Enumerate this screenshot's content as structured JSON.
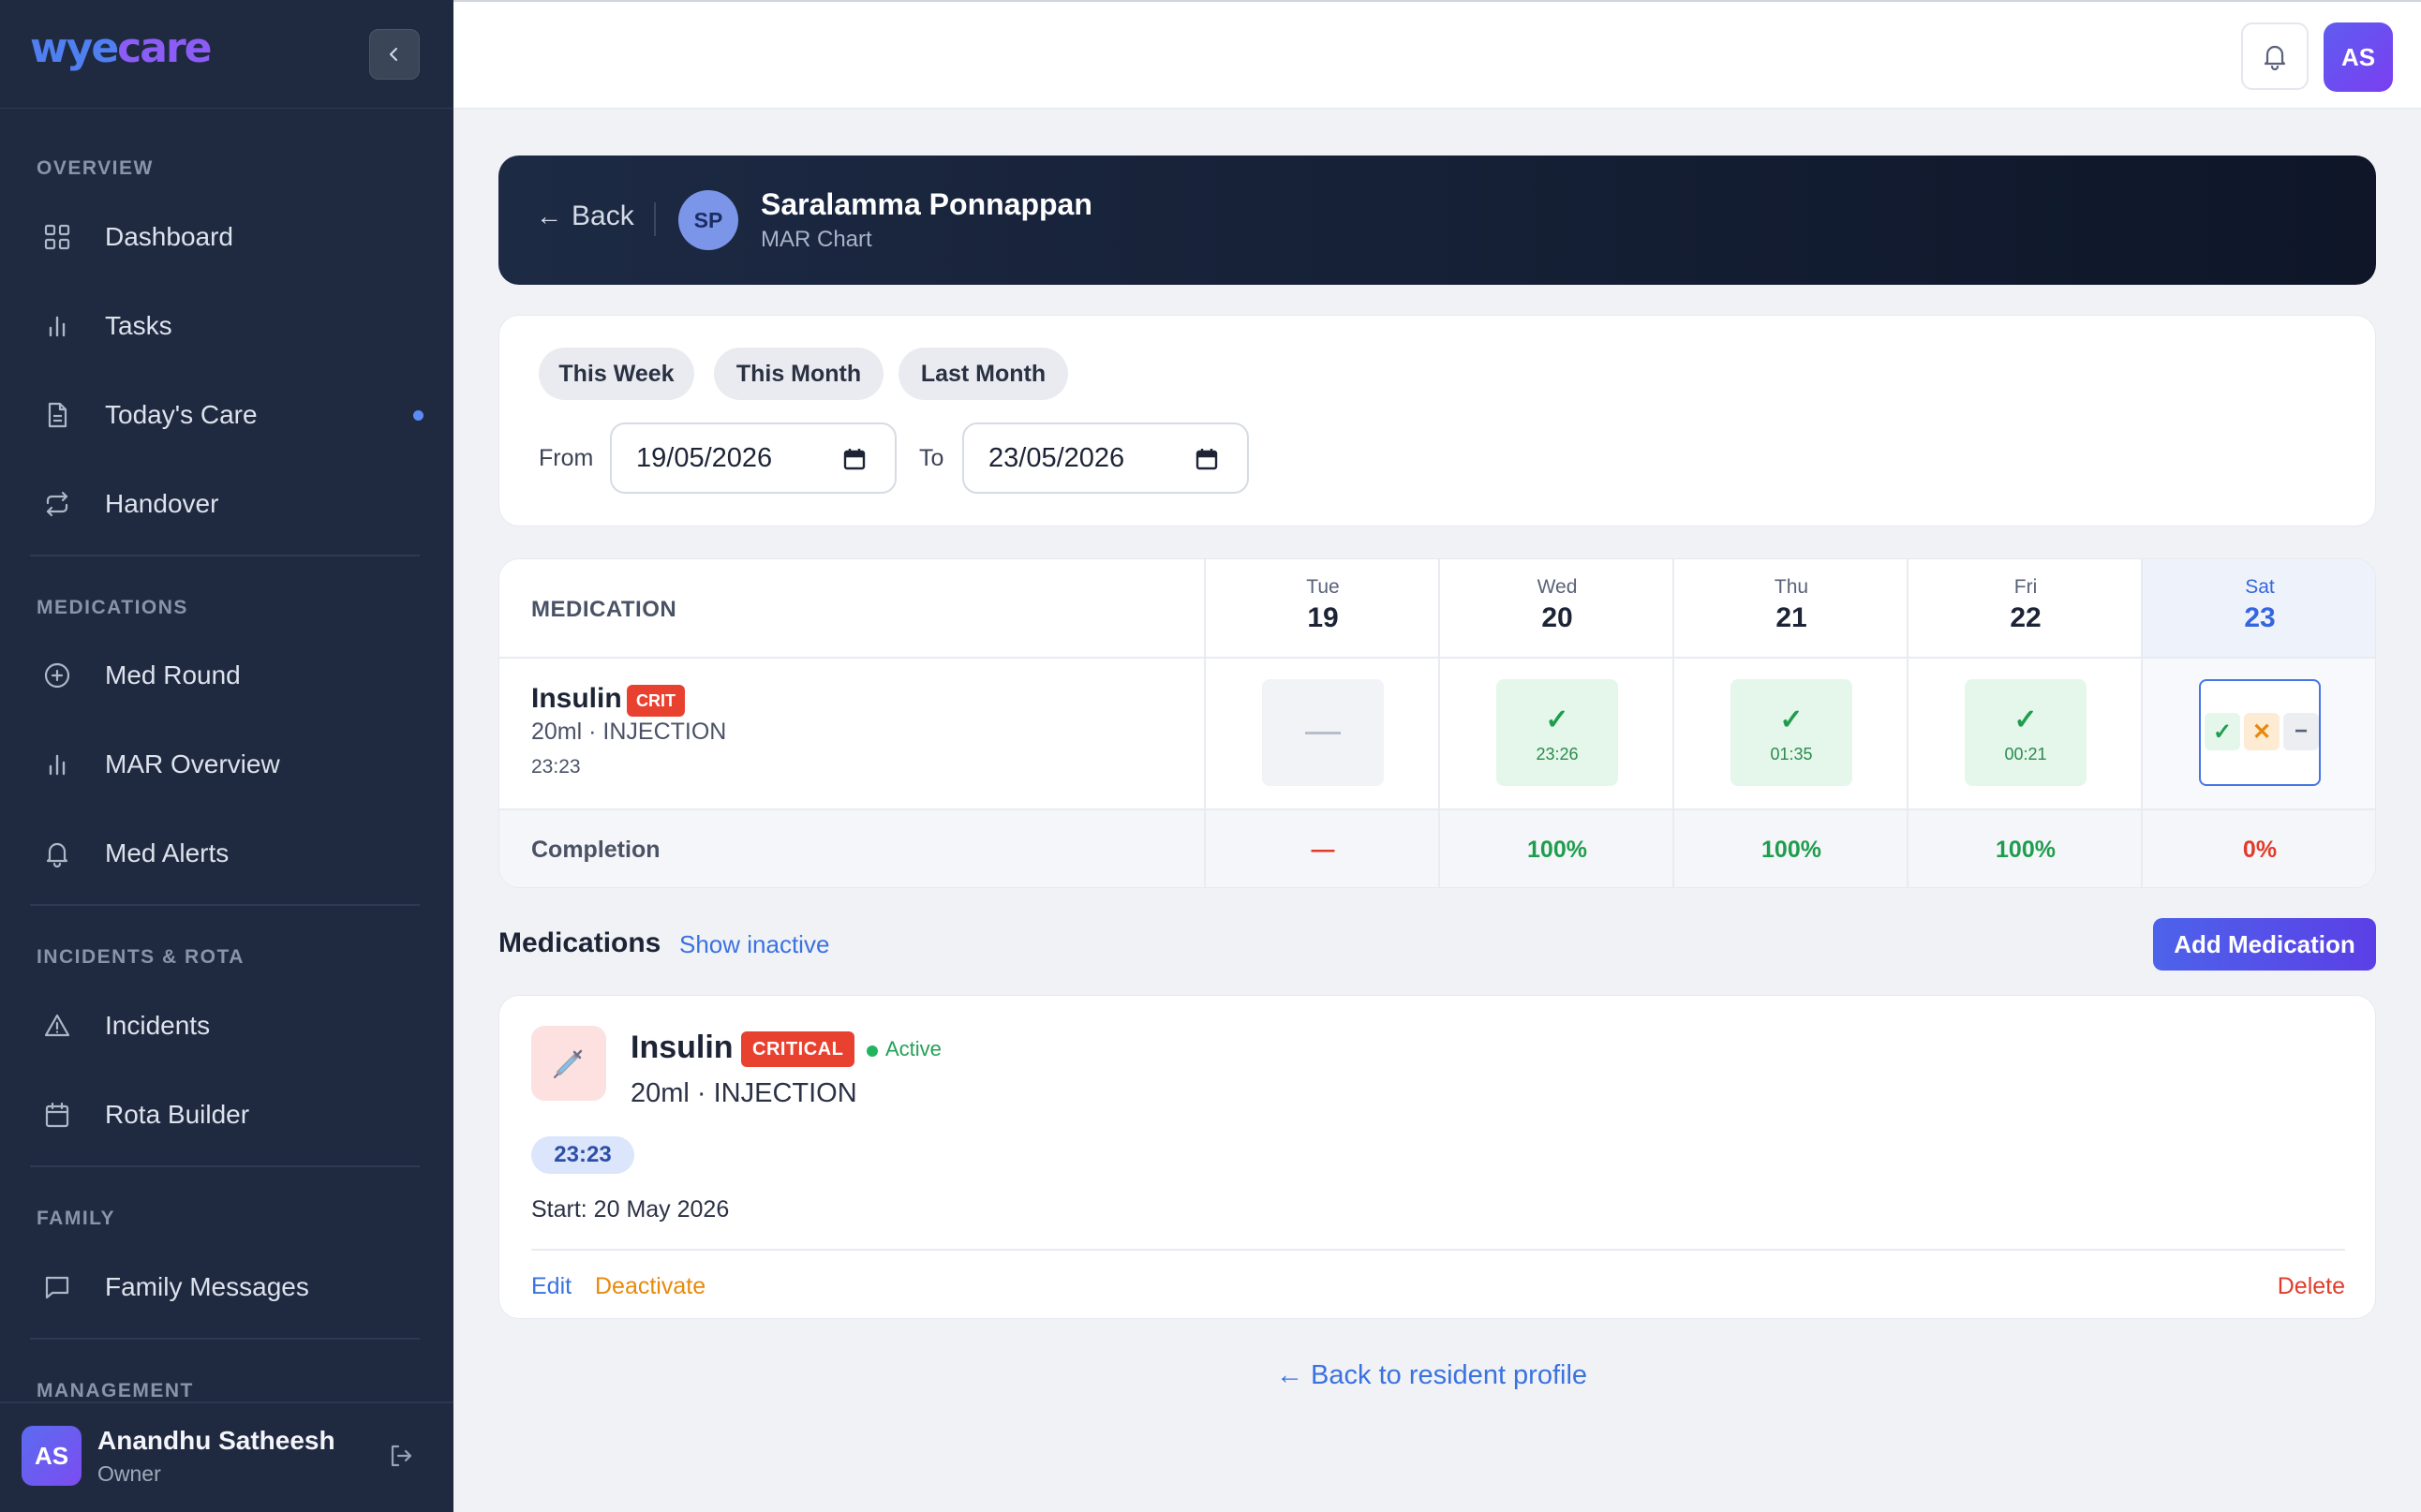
{
  "brand": {
    "part1": "wye",
    "part2": "care"
  },
  "sidebar": {
    "sections": [
      {
        "label": "OVERVIEW"
      },
      {
        "label": "MEDICATIONS"
      },
      {
        "label": "INCIDENTS & ROTA"
      },
      {
        "label": "FAMILY"
      },
      {
        "label": "MANAGEMENT"
      }
    ],
    "items": [
      {
        "label": "Dashboard",
        "icon": "grid-icon"
      },
      {
        "label": "Tasks",
        "icon": "bar-chart-icon"
      },
      {
        "label": "Today's Care",
        "icon": "document-icon",
        "has_dot": true
      },
      {
        "label": "Handover",
        "icon": "repeat-icon"
      },
      {
        "label": "Med Round",
        "icon": "plus-circle-icon"
      },
      {
        "label": "MAR Overview",
        "icon": "bar-chart-icon"
      },
      {
        "label": "Med Alerts",
        "icon": "bell-icon"
      },
      {
        "label": "Incidents",
        "icon": "warning-icon"
      },
      {
        "label": "Rota Builder",
        "icon": "calendar-icon"
      },
      {
        "label": "Family Messages",
        "icon": "message-icon"
      }
    ],
    "user": {
      "initials": "AS",
      "name": "Anandhu Satheesh",
      "role": "Owner"
    }
  },
  "topbar": {
    "avatar_initials": "AS"
  },
  "header": {
    "back_label": "Back",
    "avatar_initials": "SP",
    "resident_name": "Saralamma Ponnappan",
    "subtitle": "MAR Chart"
  },
  "filters": {
    "presets": [
      "This Week",
      "This Month",
      "Last Month"
    ],
    "from_label": "From",
    "from_value": "19/05/2026",
    "to_label": "To",
    "to_value": "23/05/2026"
  },
  "mar": {
    "column_header": "MEDICATION",
    "days": [
      {
        "name": "Tue",
        "date": "19"
      },
      {
        "name": "Wed",
        "date": "20"
      },
      {
        "name": "Thu",
        "date": "21"
      },
      {
        "name": "Fri",
        "date": "22"
      },
      {
        "name": "Sat",
        "date": "23",
        "today": true
      }
    ],
    "row": {
      "name": "Insulin",
      "badge": "CRIT",
      "dose": "20ml · INJECTION",
      "time": "23:23",
      "cells": [
        {
          "status": "none"
        },
        {
          "status": "given",
          "time": "23:26"
        },
        {
          "status": "given",
          "time": "01:35"
        },
        {
          "status": "given",
          "time": "00:21"
        },
        {
          "status": "pending"
        }
      ]
    },
    "completion_label": "Completion",
    "completion": [
      "—",
      "100%",
      "100%",
      "100%",
      "0%"
    ],
    "colors": {
      "given": "#1f9d4e",
      "refused": "#e8890c",
      "critical": "#e8412f"
    }
  },
  "medications": {
    "title": "Medications",
    "show_inactive": "Show inactive",
    "add_button": "Add Medication",
    "card": {
      "name": "Insulin",
      "badge": "CRITICAL",
      "status": "Active",
      "dose": "20ml · INJECTION",
      "time": "23:23",
      "start": "Start: 20 May 2026",
      "edit": "Edit",
      "deactivate": "Deactivate",
      "delete": "Delete"
    }
  },
  "back_to_profile": "← Back to resident profile"
}
